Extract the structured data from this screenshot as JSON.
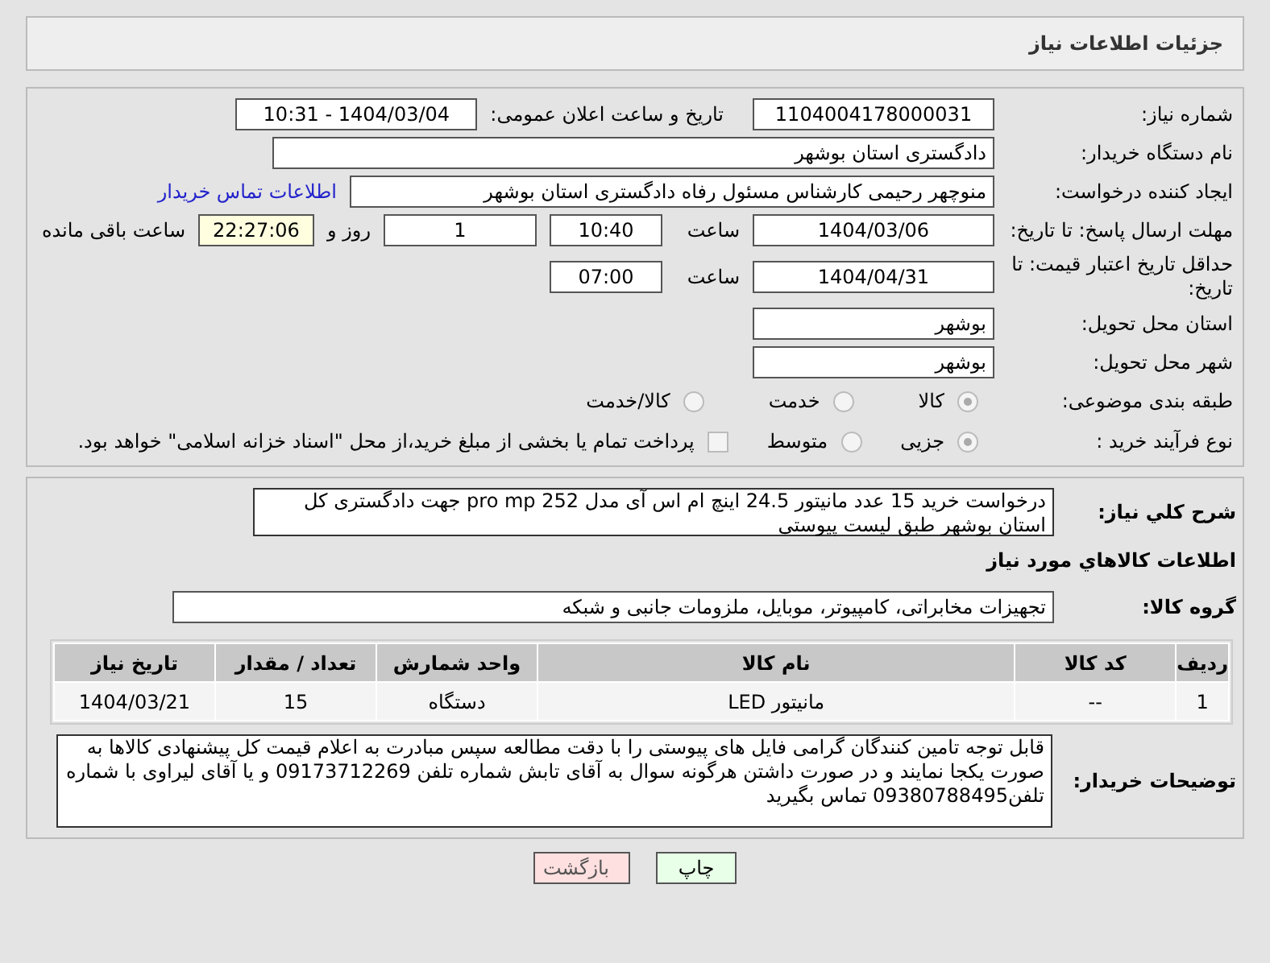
{
  "header": {
    "title": "جزئیات اطلاعات نیاز"
  },
  "need_number": {
    "label": "شماره نیاز:",
    "value": "1104004178000031"
  },
  "announce": {
    "label": "تاریخ و ساعت اعلان عمومی:",
    "value": "1404/03/04 - 10:31"
  },
  "buyer_org": {
    "label": "نام دستگاه خریدار:",
    "value": "دادگستری استان بوشهر"
  },
  "creator": {
    "label": "ایجاد کننده درخواست:",
    "value": "منوچهر رحیمی کارشناس مسئول رفاه دادگستری استان بوشهر",
    "link": "اطلاعات تماس خریدار"
  },
  "deadline": {
    "label": "مهلت ارسال پاسخ: تا تاریخ:",
    "date": "1404/03/06",
    "time_label": "ساعت",
    "time": "10:40",
    "days": "1",
    "days_label": "روز و",
    "remaining": "22:27:06",
    "remaining_label": "ساعت باقی مانده"
  },
  "validity": {
    "label": "حداقل تاریخ اعتبار قیمت: تا تاریخ:",
    "date": "1404/04/31",
    "time_label": "ساعت",
    "time": "07:00"
  },
  "province": {
    "label": "استان محل تحویل:",
    "value": "بوشهر"
  },
  "city": {
    "label": "شهر محل تحویل:",
    "value": "بوشهر"
  },
  "category": {
    "label": "طبقه بندی موضوعی:",
    "options": [
      {
        "label": "کالا",
        "selected": true
      },
      {
        "label": "خدمت",
        "selected": false
      },
      {
        "label": "کالا/خدمت",
        "selected": false
      }
    ]
  },
  "process": {
    "label": "نوع فرآیند خرید :",
    "options": [
      {
        "label": "جزیی",
        "selected": true
      },
      {
        "label": "متوسط",
        "selected": false
      }
    ],
    "payment": {
      "label": "پرداخت تمام یا بخشی از مبلغ خرید،از محل \"اسناد خزانه اسلامی\" خواهد بود.",
      "checked": false
    }
  },
  "description": {
    "label": "شرح کلي نياز:",
    "value": "درخواست خرید 15 عدد مانیتور 24.5 اینچ ام اس آی مدل pro mp 252 جهت دادگستری کل استان بوشهر طبق لیست پیوستی"
  },
  "goods_heading": "اطلاعات کالاهاي مورد نياز",
  "goods_group": {
    "label": "گروه کالا:",
    "value": "تجهیزات مخابراتی، کامپیوتر، موبایل، ملزومات جانبی و شبکه"
  },
  "table": {
    "columns": [
      "ردیف",
      "کد کالا",
      "نام کالا",
      "واحد شمارش",
      "تعداد / مقدار",
      "تاریخ نیاز"
    ],
    "rows": [
      [
        "1",
        "--",
        "مانیتور LED",
        "دستگاه",
        "15",
        "1404/03/21"
      ]
    ]
  },
  "buyer_notes": {
    "label": "توضیحات خریدار:",
    "value": "قابل توجه تامین کنندگان گرامی فایل های پیوستی را با دقت مطالعه سپس مبادرت به اعلام قیمت کل پیشنهادی کالاها به صورت یکجا نمایند و در صورت داشتن هرگونه سوال به آقای تابش شماره تلفن 09173712269 و یا آقای لیراوی با شماره تلفن09380788495 تماس بگیرید"
  },
  "buttons": [
    {
      "label": "چاپ",
      "kind": "print"
    },
    {
      "label": "بازگشت",
      "kind": "back"
    }
  ]
}
